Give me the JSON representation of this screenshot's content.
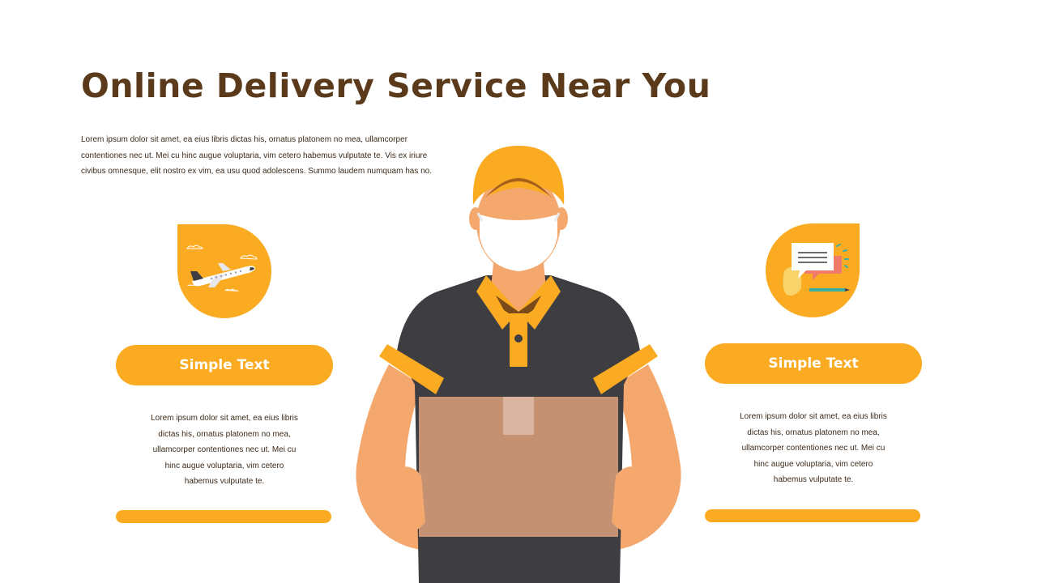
{
  "title": "Online Delivery Service Near You",
  "intro": "Lorem ipsum dolor sit amet, ea eius libris dictas his, ornatus platonem no mea, ullamcorper contentiones nec ut. Mei cu hinc augue voluptaria, vim cetero habemus vulputate te. Vis ex iriure civibus omnesque, elit nostro ex vim, ea usu quod adolescens. Summo laudem numquam has no.",
  "left_card": {
    "icon": "airplane-icon",
    "label": "Simple Text",
    "text": "Lorem ipsum dolor sit amet, ea eius libris dictas his, ornatus platonem no mea, ullamcorper contentiones nec ut. Mei cu hinc augue voluptaria, vim cetero habemus vulputate te."
  },
  "right_card": {
    "icon": "chat-message-icon",
    "label": "Simple Text",
    "text": "Lorem ipsum dolor sit amet, ea eius libris dictas his, ornatus platonem no mea, ullamcorper contentiones nec ut. Mei cu hinc augue voluptaria, vim cetero habemus vulputate te."
  },
  "illustration": "delivery-person-illustration",
  "colors": {
    "accent": "#fbab22",
    "title": "#5a3a1a",
    "shirt": "#3d3d42",
    "skin": "#f5a86d",
    "box": "#c49173"
  }
}
